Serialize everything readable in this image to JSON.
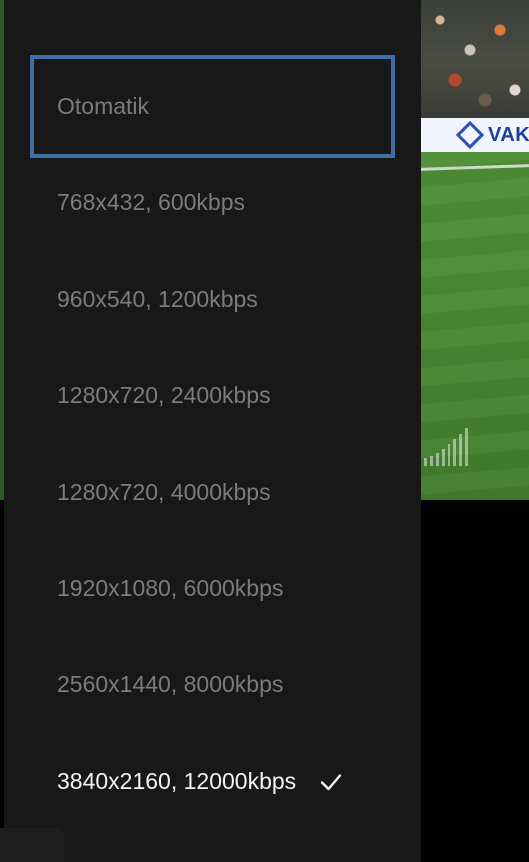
{
  "video": {
    "ad_board_text": "VAKI"
  },
  "quality_menu": {
    "options": [
      {
        "label": "Otomatik",
        "state": "focused"
      },
      {
        "label": "768x432, 600kbps",
        "state": "normal"
      },
      {
        "label": "960x540, 1200kbps",
        "state": "normal"
      },
      {
        "label": "1280x720, 2400kbps",
        "state": "normal"
      },
      {
        "label": "1280x720, 4000kbps",
        "state": "normal"
      },
      {
        "label": "1920x1080, 6000kbps",
        "state": "normal"
      },
      {
        "label": "2560x1440, 8000kbps",
        "state": "normal"
      },
      {
        "label": "3840x2160, 12000kbps",
        "state": "selected",
        "icon": "checkmark-icon"
      }
    ]
  },
  "colors": {
    "menu_background": "#181818",
    "focus_border": "#3f6fa9",
    "option_text": "#7b7b80",
    "selected_text": "#f2f2f2"
  }
}
